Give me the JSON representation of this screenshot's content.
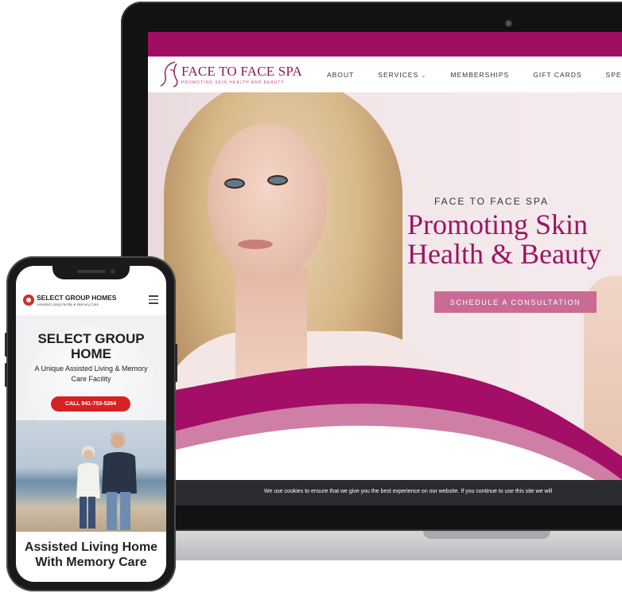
{
  "spa": {
    "logo_name": "FACE TO FACE SPA",
    "logo_tagline": "PROMOTING SKIN HEALTH AND BEAUTY",
    "nav": [
      {
        "label": "ABOUT"
      },
      {
        "label": "SERVICES"
      },
      {
        "label": "MEMBERSHIPS"
      },
      {
        "label": "GIFT CARDS"
      },
      {
        "label": "SPECIALS"
      }
    ],
    "hero_kicker": "FACE TO FACE SPA",
    "hero_title_line1": "Promoting Skin",
    "hero_title_line2": "Health & Beauty",
    "hero_cta": "SCHEDULE A CONSULTATION",
    "cookie_text": "We use cookies to ensure that we give you the best experience on our website. If you continue to use this site we will",
    "colors": {
      "brand": "#9e0e63",
      "accent": "#c96b95",
      "title": "#9b1463"
    }
  },
  "selectgroup": {
    "logo_name": "SELECT GROUP HOMES",
    "logo_sub": "Assisted Living Facility & Memory Care",
    "hero_title": "SELECT GROUP HOME",
    "hero_desc": "A Unique Assisted Living & Memory Care Facility",
    "call_label": "CALL 941-753-5264",
    "section_title": "Assisted Living Home With Memory Care",
    "colors": {
      "cta": "#d72222"
    }
  }
}
